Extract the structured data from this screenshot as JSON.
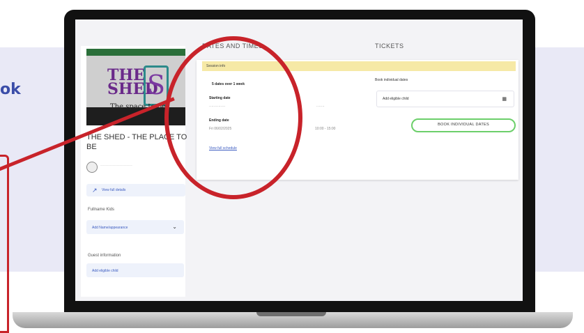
{
  "promo": {
    "word_fragment": "ok"
  },
  "sidebar": {
    "image": {
      "brand_line1": "THE",
      "brand_line2": "SHED",
      "logo_letter": "S",
      "tagline": "The space to be"
    },
    "event_title": "THE SHED - THE PLACE TO BE",
    "view_details_label": "View full details",
    "fullname_label": "Fullname Kids",
    "fullname_value": "Add Name/appearance",
    "guest_label": "Guest information",
    "guest_value": "Add eligible child"
  },
  "main": {
    "dates_header": "DATES AND TIMES",
    "tickets_header": "TICKETS",
    "banner": "Session info",
    "schedule_summary": "5 dates over 1 week",
    "starting_label": "Starting date",
    "ending_label": "Ending date",
    "ending_value": "Fri 06/02/2025",
    "time_range": "10:00 - 15:00",
    "view_full_schedule": "View full schedule",
    "book_label": "Book individual dates",
    "child_select": "Add eligible child",
    "book_button": "BOOK INDIVIDUAL DATES"
  },
  "colors": {
    "accent": "#3b5bc0",
    "highlight_ring": "#c8232a",
    "book_button_border": "#6ccf6a",
    "banner": "#f6e9a6"
  }
}
